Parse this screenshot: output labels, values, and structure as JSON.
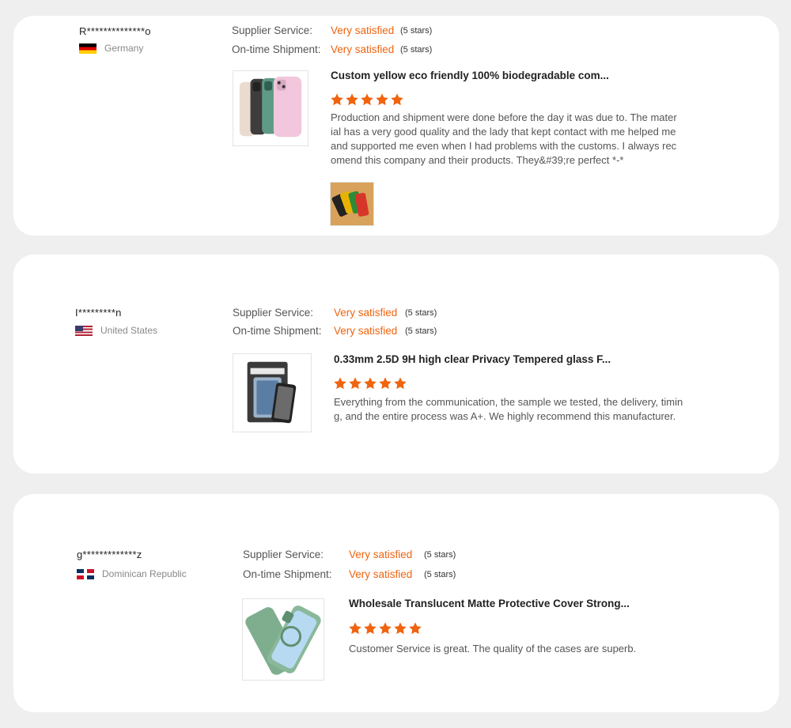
{
  "reviews": [
    {
      "user": "R**************o",
      "country": "Germany",
      "supplier_label": "Supplier Service:",
      "supplier_value": "Very satisfied",
      "supplier_stars": "(5 stars)",
      "shipment_label": "On-time Shipment:",
      "shipment_value": "Very satisfied",
      "shipment_stars": "(5 stars)",
      "product_title": "Custom yellow eco friendly 100% biodegradable com...",
      "rating": 5,
      "text": "Production and shipment were done before the day it was due to. The material has a very good quality and the lady that kept contact with me helped me and supported me even when I had problems with the customs. I always recomend this company and their products. They&#39;re perfect *-*"
    },
    {
      "user": "I*********n",
      "country": "United States",
      "supplier_label": "Supplier Service:",
      "supplier_value": "Very satisfied",
      "supplier_stars": "(5 stars)",
      "shipment_label": "On-time Shipment:",
      "shipment_value": "Very satisfied",
      "shipment_stars": "(5 stars)",
      "product_title": "0.33mm 2.5D 9H high clear Privacy Tempered glass F...",
      "rating": 5,
      "text": "Everything from the communication, the sample we tested, the delivery, timing, and the entire process was A+. We highly recommend this manufacturer."
    },
    {
      "user": "g*************z",
      "country": "Dominican Republic",
      "supplier_label": "Supplier Service:",
      "supplier_value": "Very satisfied",
      "supplier_stars": "(5 stars)",
      "shipment_label": "On-time Shipment:",
      "shipment_value": "Very satisfied",
      "shipment_stars": "(5 stars)",
      "product_title": "Wholesale Translucent Matte Protective Cover Strong...",
      "rating": 5,
      "text": "Customer Service is great. The quality of the cases are superb."
    }
  ],
  "colors": {
    "accent": "#f0640f",
    "star": "#f0640f",
    "card": "#ffffff",
    "page": "#efefef"
  }
}
